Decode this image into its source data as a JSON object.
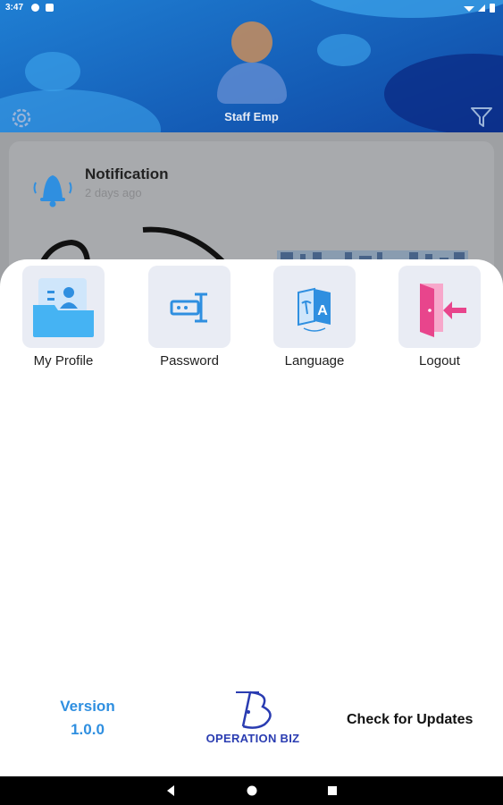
{
  "status_bar": {
    "time": "3:47"
  },
  "header": {
    "user_name": "Staff Emp",
    "settings_icon": "gear-icon",
    "filter_icon": "filter-icon"
  },
  "notification": {
    "title": "Notification",
    "time": "2 days ago",
    "icon": "bell-icon"
  },
  "menu": {
    "items": [
      {
        "label": "My Profile",
        "icon": "profile-folder-icon"
      },
      {
        "label": "Password",
        "icon": "password-icon"
      },
      {
        "label": "Language",
        "icon": "language-icon"
      },
      {
        "label": "Logout",
        "icon": "logout-icon"
      }
    ]
  },
  "footer": {
    "version_label": "Version",
    "version_number": "1.0.0",
    "logo_text": "OPERATION BIZ",
    "check_updates": "Check for Updates"
  },
  "colors": {
    "accent": "#2f8fe0",
    "header_dark": "#0d2f8f",
    "logo": "#2a3cb1",
    "logout_pink": "#e8458c"
  }
}
